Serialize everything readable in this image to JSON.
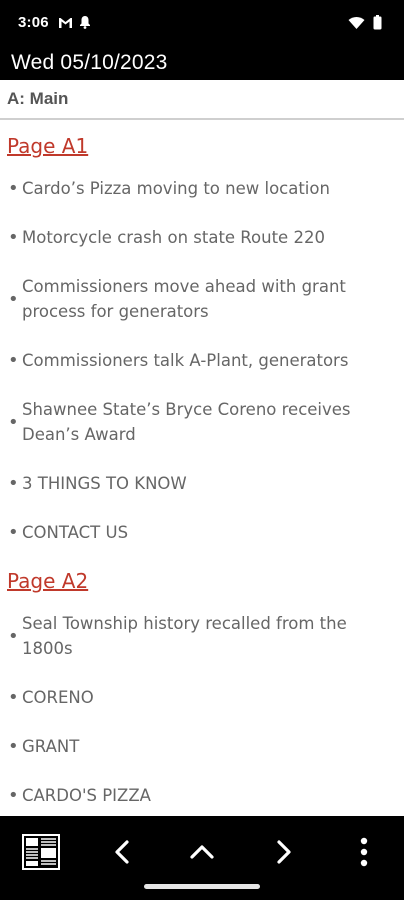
{
  "status_bar": {
    "time": "3:06",
    "icons_left": [
      "gmail-icon",
      "notification-bell-icon"
    ],
    "icons_right": [
      "wifi-icon",
      "battery-icon"
    ]
  },
  "header": {
    "date": "Wed 05/10/2023"
  },
  "section": {
    "title": "A: Main"
  },
  "pages": [
    {
      "heading": "Page A1",
      "articles": [
        "Cardo’s Pizza moving to new location",
        "Motorcycle crash on state Route 220",
        "Commissioners move ahead with grant process for generators",
        "Commissioners talk A-Plant, generators",
        "Shawnee State’s  Bryce Coreno receives Dean’s Award",
        "3 THINGS TO KNOW",
        "CONTACT US"
      ]
    },
    {
      "heading": "Page A2",
      "articles": [
        "Seal Township history recalled from the 1800s",
        "CORENO",
        "GRANT",
        "CARDO'S PIZZA"
      ]
    }
  ],
  "bottom_nav": {
    "buttons": [
      "newspaper-page-icon",
      "chevron-left-icon",
      "chevron-up-icon",
      "chevron-right-icon",
      "more-vert-icon"
    ]
  },
  "colors": {
    "link": "#c0392b",
    "text": "#666666",
    "bar": "#000000"
  }
}
